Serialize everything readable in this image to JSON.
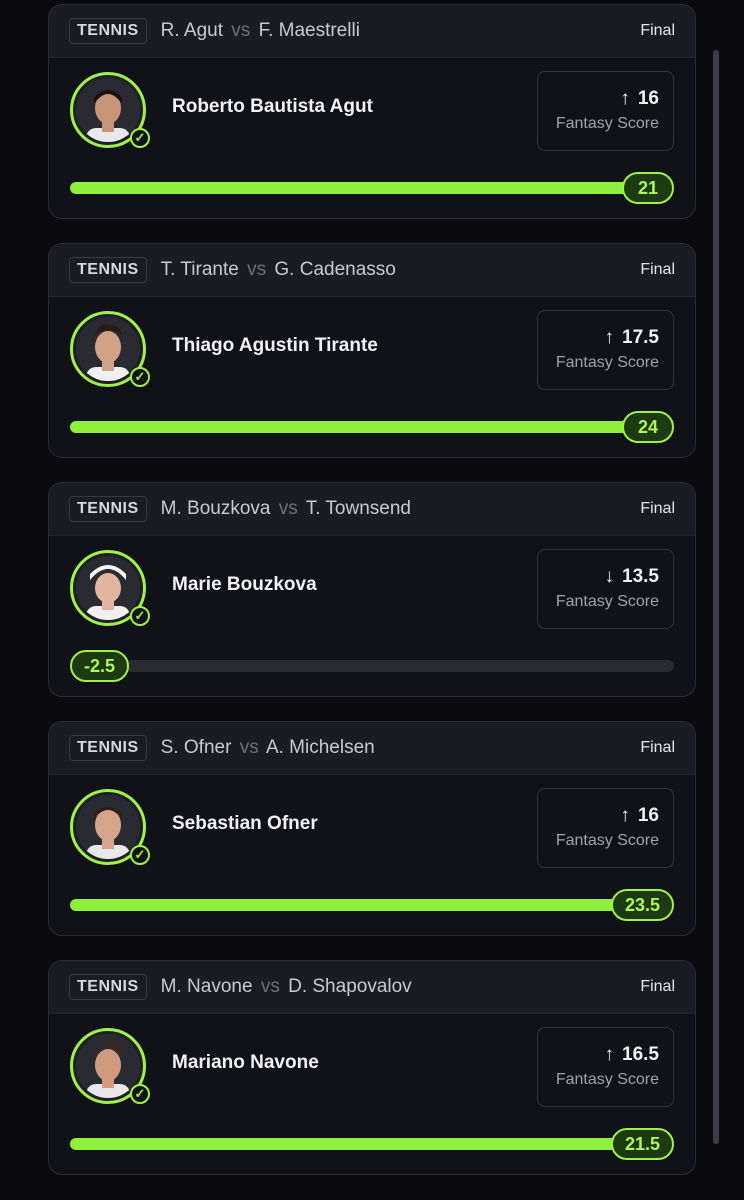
{
  "colors": {
    "accent": "#9ef24a",
    "card_bg": "#111118",
    "page_bg": "#0b0b0f"
  },
  "cards": [
    {
      "sport": "TENNIS",
      "player1": "R. Agut",
      "vs": "vs",
      "player2": "F. Maestrelli",
      "status": "Final",
      "player_name": "Roberto Bautista Agut",
      "direction": "up",
      "arrow": "↑",
      "line": "16",
      "score_label": "Fantasy Score",
      "actual": "21",
      "progress": 1.0,
      "avatar": {
        "skin": "#c89478",
        "hair": "#1a1410",
        "shirt": "#e8e8ea"
      }
    },
    {
      "sport": "TENNIS",
      "player1": "T. Tirante",
      "vs": "vs",
      "player2": "G. Cadenasso",
      "status": "Final",
      "player_name": "Thiago Agustin Tirante",
      "direction": "up",
      "arrow": "↑",
      "line": "17.5",
      "score_label": "Fantasy Score",
      "actual": "24",
      "progress": 1.0,
      "avatar": {
        "skin": "#d2a286",
        "hair": "#2a1c14",
        "shirt": "#f0f0f2"
      }
    },
    {
      "sport": "TENNIS",
      "player1": "M. Bouzkova",
      "vs": "vs",
      "player2": "T. Townsend",
      "status": "Final",
      "player_name": "Marie Bouzkova",
      "direction": "down",
      "arrow": "↓",
      "line": "13.5",
      "score_label": "Fantasy Score",
      "actual": "-2.5",
      "progress": 0.0,
      "avatar": {
        "skin": "#e2b69c",
        "hair": "#f4f4f6",
        "shirt": "#f0f0f2"
      }
    },
    {
      "sport": "TENNIS",
      "player1": "S. Ofner",
      "vs": "vs",
      "player2": "A. Michelsen",
      "status": "Final",
      "player_name": "Sebastian Ofner",
      "direction": "up",
      "arrow": "↑",
      "line": "16",
      "score_label": "Fantasy Score",
      "actual": "23.5",
      "progress": 1.0,
      "avatar": {
        "skin": "#d6a48a",
        "hair": "#2b2018",
        "shirt": "#e8e8ea"
      }
    },
    {
      "sport": "TENNIS",
      "player1": "M. Navone",
      "vs": "vs",
      "player2": "D. Shapovalov",
      "status": "Final",
      "player_name": "Mariano Navone",
      "direction": "up",
      "arrow": "↑",
      "line": "16.5",
      "score_label": "Fantasy Score",
      "actual": "21.5",
      "progress": 1.0,
      "avatar": {
        "skin": "#cf9a7e",
        "hair": "#3a281c",
        "shirt": "#e8e8ea"
      }
    }
  ]
}
